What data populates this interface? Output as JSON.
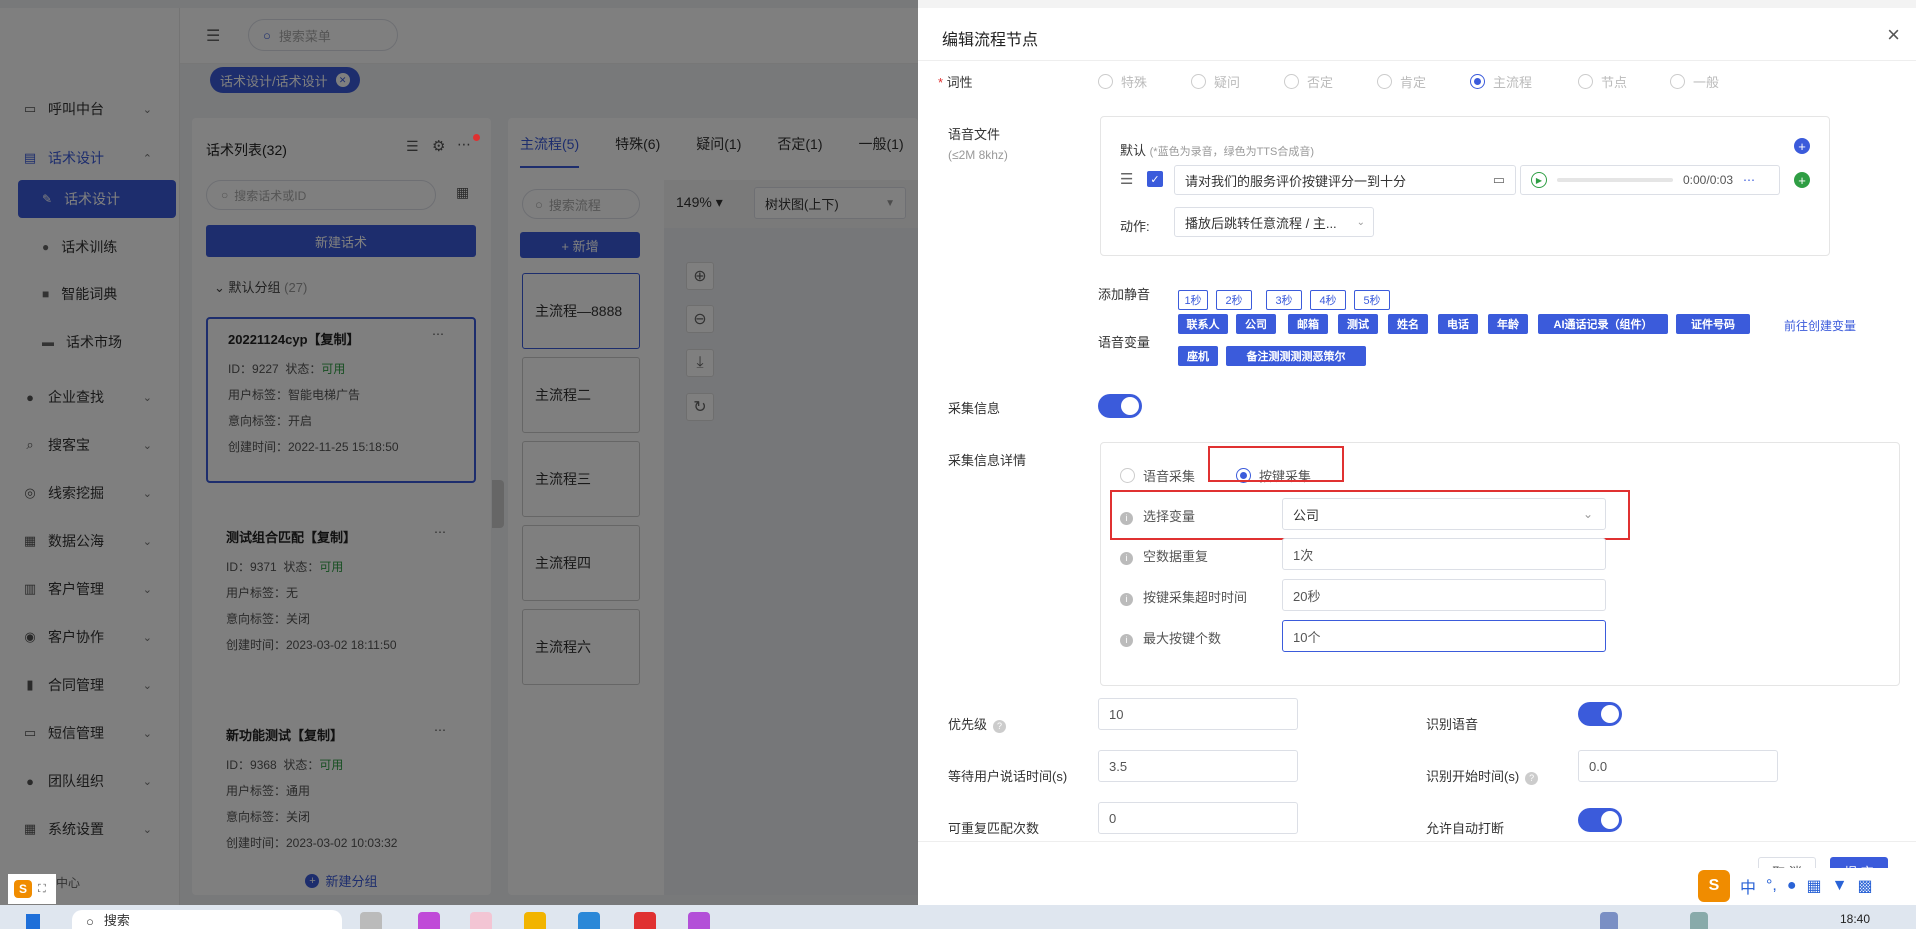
{
  "header": {
    "search_placeholder": "搜索菜单"
  },
  "tag": {
    "label": "话术设计/话术设计",
    "close": "✕"
  },
  "sidebar": {
    "items": [
      {
        "label": "呼叫中台",
        "icon": "monitor-icon"
      },
      {
        "label": "话术设计",
        "icon": "document-icon"
      },
      {
        "label": "企业查找",
        "icon": "bulb-icon"
      },
      {
        "label": "搜客宝",
        "icon": "search-icon"
      },
      {
        "label": "线索挖掘",
        "icon": "target-icon"
      },
      {
        "label": "数据公海",
        "icon": "chart-icon"
      },
      {
        "label": "客户管理",
        "icon": "customer-icon"
      },
      {
        "label": "客户协作",
        "icon": "cooperate-icon"
      },
      {
        "label": "合同管理",
        "icon": "contract-icon"
      },
      {
        "label": "短信管理",
        "icon": "sms-icon"
      },
      {
        "label": "团队组织",
        "icon": "team-icon"
      },
      {
        "label": "系统设置",
        "icon": "settings-icon"
      }
    ],
    "subitems": [
      "话术设计",
      "话术训练",
      "智能词典",
      "话术市场"
    ],
    "help": "帮助中心"
  },
  "scripts_panel": {
    "title": "话术列表(32)",
    "search_placeholder": "搜索话术或ID",
    "new_button": "新建话术",
    "group": "默认分组",
    "group_count": "(27)",
    "new_group": "新建分组",
    "cards": [
      {
        "title": "20221124cyp【复制】",
        "id_label": "ID：",
        "id": "9227",
        "status_label": "状态：",
        "status": "可用",
        "user_tag": "用户标签：智能电梯广告",
        "intent_tag": "意向标签：开启",
        "created": "创建时间：2022-11-25 15:18:50"
      },
      {
        "title": "测试组合匹配【复制】",
        "id_label": "ID：",
        "id": "9371",
        "status_label": "状态：",
        "status": "可用",
        "user_tag": "用户标签：无",
        "intent_tag": "意向标签：关闭",
        "created": "创建时间：2023-03-02 18:11:50"
      },
      {
        "title": "新功能测试【复制】",
        "id_label": "ID：",
        "id": "9368",
        "status_label": "状态：",
        "status": "可用",
        "user_tag": "用户标签：通用",
        "intent_tag": "意向标签：关闭",
        "created": "创建时间：2023-03-02 10:03:32"
      }
    ]
  },
  "flow_panel": {
    "tabs": [
      "主流程(5)",
      "特殊(6)",
      "疑问(1)",
      "否定(1)",
      "一般(1)"
    ],
    "search_placeholder": "搜索流程",
    "add_button": "+ 新增",
    "zoom": "149%",
    "view": "树状图(上下)",
    "nodes": [
      "主流程—8888",
      "主流程二",
      "主流程三",
      "主流程四",
      "主流程六"
    ]
  },
  "drawer": {
    "title": "编辑流程节点",
    "pos_label": "词性",
    "pos_options": [
      "特殊",
      "疑问",
      "否定",
      "肯定",
      "主流程",
      "节点",
      "一般"
    ],
    "pos_selected": "主流程",
    "audio_label": "语音文件",
    "audio_sub": "(≤2M 8khz)",
    "default_label": "默认",
    "default_hint": "(*蓝色为录音，绿色为TTS合成音)",
    "audio_text": "请对我们的服务评价按键评分一到十分",
    "audio_time": "0:00/0:03",
    "action_label": "动作:",
    "action_value": "播放后跳转任意流程 / 主...",
    "silence_label": "添加静音",
    "silence_options": [
      "1秒",
      "2秒",
      "3秒",
      "4秒",
      "5秒"
    ],
    "var_label": "语音变量",
    "variables": [
      "联系人",
      "公司",
      "邮箱",
      "测试",
      "姓名",
      "电话",
      "年龄",
      "AI通话记录（组件）",
      "证件号码",
      "座机",
      "备注测测测测恶策尔"
    ],
    "create_var_link": "前往创建变量",
    "collect_label": "采集信息",
    "collect_detail_label": "采集信息详情",
    "collect_modes": [
      "语音采集",
      "按键采集"
    ],
    "collect_selected": "按键采集",
    "fields": [
      {
        "label": "选择变量",
        "value": "公司"
      },
      {
        "label": "空数据重复",
        "value": "1次"
      },
      {
        "label": "按键采集超时时间",
        "value": "20秒"
      },
      {
        "label": "最大按键个数",
        "value": "10个"
      }
    ],
    "priority_label": "优先级",
    "priority_value": "10",
    "recognize_label": "识别语音",
    "wait_label": "等待用户说话时间(s)",
    "wait_value": "3.5",
    "recognize_start_label": "识别开始时间(s)",
    "recognize_start_value": "0.0",
    "repeat_label": "可重复匹配次数",
    "repeat_value": "0",
    "interrupt_label": "允许自动打断",
    "cancel": "取 消",
    "submit": "提 交"
  },
  "taskbar": {
    "search": "搜索",
    "time": "18:40",
    "ime": "中"
  },
  "colors": {
    "primary": "#3b5bdb",
    "success": "#2f9e44",
    "highlight": "#e03131"
  }
}
